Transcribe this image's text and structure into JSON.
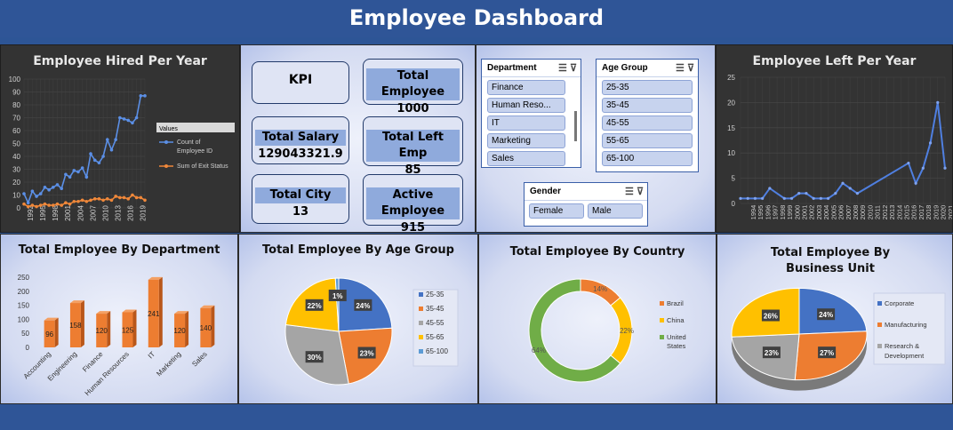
{
  "header": {
    "title": "Employee Dashboard"
  },
  "hired": {
    "title": "Employee Hired Per Year",
    "legend_heading": "Values",
    "chart_data": {
      "type": "line",
      "x": [
        "1992",
        "1993",
        "1994",
        "1995",
        "1996",
        "1997",
        "1998",
        "1999",
        "2000",
        "2001",
        "2002",
        "2003",
        "2004",
        "2005",
        "2006",
        "2007",
        "2008",
        "2009",
        "2010",
        "2011",
        "2012",
        "2013",
        "2014",
        "2015",
        "2016",
        "2017",
        "2018",
        "2019",
        "2020",
        "2021"
      ],
      "x_tick_labels": [
        "1992",
        "1995",
        "1998",
        "2001",
        "2004",
        "2007",
        "2010",
        "2013",
        "2016",
        "2019"
      ],
      "ylim": [
        0,
        100
      ],
      "y_ticks": [
        0,
        10,
        20,
        30,
        40,
        50,
        60,
        70,
        80,
        90,
        100
      ],
      "series": [
        {
          "name": "Count of Employee ID",
          "values": [
            11,
            4,
            13,
            9,
            11,
            16,
            14,
            16,
            18,
            15,
            26,
            24,
            29,
            28,
            31,
            24,
            42,
            37,
            35,
            40,
            53,
            45,
            53,
            70,
            69,
            68,
            66,
            70,
            87,
            87
          ],
          "color": "#5b8fe6"
        },
        {
          "name": "Sum of Exit Status",
          "values": [
            3,
            1,
            2,
            1,
            2,
            3,
            2,
            2,
            3,
            2,
            4,
            3,
            5,
            5,
            6,
            5,
            6,
            7,
            7,
            6,
            7,
            6,
            9,
            8,
            8,
            7,
            10,
            8,
            8,
            6
          ],
          "color": "#f0883a"
        }
      ]
    }
  },
  "kpi": {
    "heading": "KPI",
    "total_employee_label": "Total Employee",
    "total_employee_value": "1000",
    "total_salary_label": "Total Salary",
    "total_salary_value": "129043321.9",
    "total_left_label": "Total Left Emp",
    "total_left_value": "85",
    "total_city_label": "Total City",
    "total_city_value": "13",
    "active_label": "Active Employee",
    "active_value": "915"
  },
  "slicers": {
    "department": {
      "title": "Department",
      "items": [
        "Finance",
        "Human Reso...",
        "IT",
        "Marketing",
        "Sales"
      ]
    },
    "age_group": {
      "title": "Age Group",
      "items": [
        "25-35",
        "35-45",
        "45-55",
        "55-65",
        "65-100"
      ]
    },
    "gender": {
      "title": "Gender",
      "items": [
        "Female",
        "Male"
      ]
    }
  },
  "left": {
    "title": "Employee Left Per Year",
    "chart_data": {
      "type": "line",
      "x": [
        "1994",
        "1995",
        "1996",
        "1997",
        "1998",
        "1999",
        "2000",
        "2001",
        "2002",
        "2003",
        "2004",
        "2005",
        "2006",
        "2007",
        "2008",
        "2009",
        "2010",
        "2011",
        "2012",
        "2013",
        "2014",
        "2015",
        "2016",
        "2017",
        "2018",
        "2019",
        "2020",
        "2021",
        "2022"
      ],
      "ylim": [
        0,
        25
      ],
      "y_ticks": [
        0,
        5,
        10,
        15,
        20,
        25
      ],
      "series": [
        {
          "values": [
            1,
            1,
            1,
            1,
            3,
            1,
            1,
            2,
            2,
            1,
            1,
            1,
            2,
            4,
            3,
            2,
            8,
            4,
            7,
            12,
            20,
            7
          ],
          "color": "#4f7fe0"
        }
      ],
      "series_x": [
        "1994",
        "1995",
        "1996",
        "1997",
        "1998",
        "1999",
        "2000",
        "2001",
        "2002",
        "2003",
        "2004",
        "2005",
        "2006",
        "2007",
        "2008",
        "2009",
        "2010",
        "2011",
        "2012",
        "2013",
        "2014",
        "2015",
        "2016",
        "2017",
        "2018",
        "2019",
        "2020",
        "2021",
        "2022"
      ]
    }
  },
  "department": {
    "title": "Total Employee By Department",
    "chart_data": {
      "type": "bar",
      "categories": [
        "Accounting",
        "Engineering",
        "Finance",
        "Human Resources",
        "IT",
        "Marketing",
        "Sales"
      ],
      "values": [
        96,
        158,
        120,
        125,
        241,
        120,
        140
      ],
      "ylim": [
        0,
        250
      ],
      "y_ticks": [
        0,
        50,
        100,
        150,
        200,
        250
      ],
      "color": "#ed7d31"
    }
  },
  "age_group": {
    "title": "Total Employee By Age Group",
    "chart_data": {
      "type": "pie",
      "categories": [
        "25-35",
        "35-45",
        "45-55",
        "55-65",
        "65-100"
      ],
      "values": [
        24,
        23,
        30,
        22,
        1
      ],
      "labels": [
        "24%",
        "23%",
        "30%",
        "22%",
        "1%"
      ],
      "colors": [
        "#4472c4",
        "#ed7d31",
        "#a5a5a5",
        "#ffc000",
        "#5b9bd5"
      ]
    }
  },
  "country": {
    "title": "Total Employee By Country",
    "chart_data": {
      "type": "pie",
      "categories": [
        "Brazil",
        "China",
        "United States"
      ],
      "values": [
        14,
        22,
        64
      ],
      "labels": [
        "14%",
        "22%",
        "64%"
      ],
      "colors": [
        "#ed7d31",
        "#ffc000",
        "#70ad47"
      ]
    }
  },
  "business_unit": {
    "title": "Total Employee By Business Unit",
    "chart_data": {
      "type": "pie",
      "categories": [
        "Corporate",
        "Manufacturing",
        "Research & Development"
      ],
      "values": [
        24,
        27,
        23,
        26
      ],
      "labels": [
        "24%",
        "27%",
        "23%",
        "26%"
      ],
      "colors": [
        "#4472c4",
        "#ed7d31",
        "#a5a5a5",
        "#ffc000"
      ]
    }
  }
}
